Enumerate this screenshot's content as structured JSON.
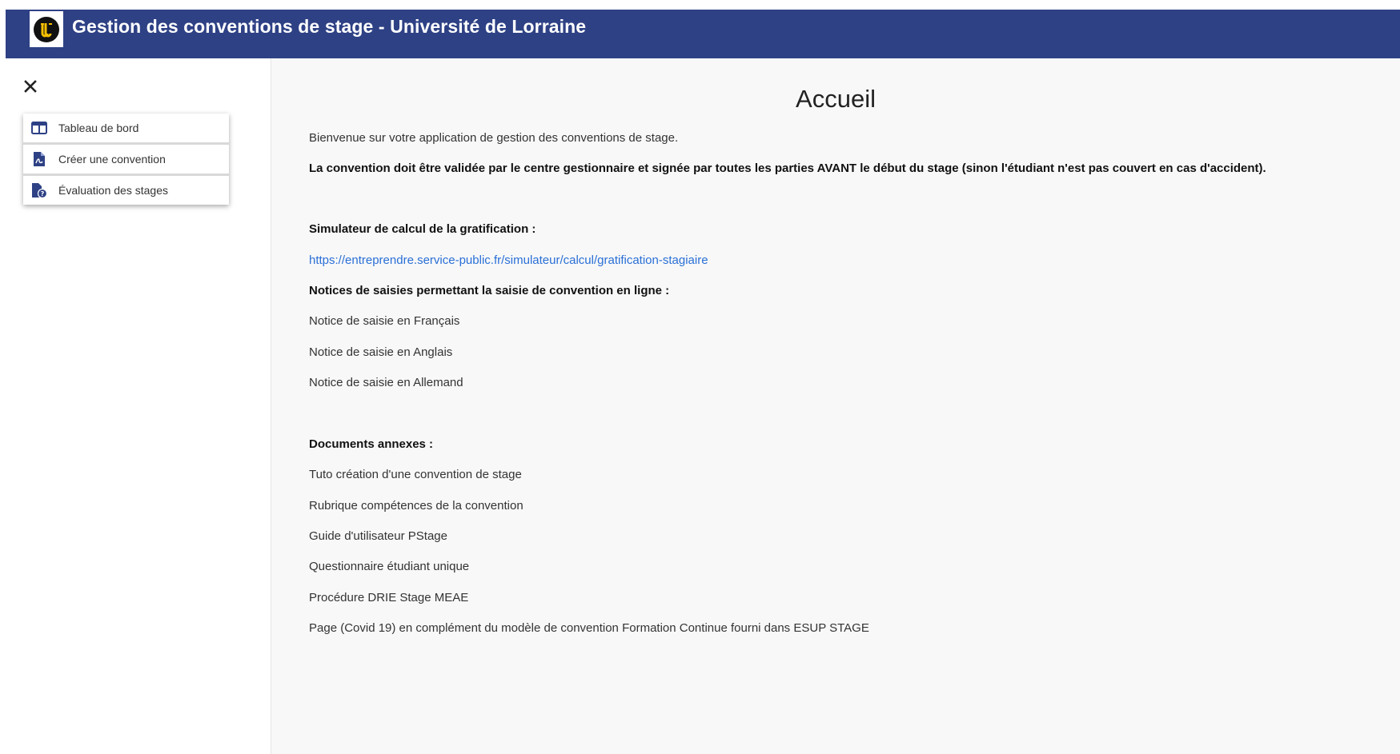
{
  "header": {
    "title": "Gestion des conventions de stage - Université de Lorraine",
    "logo_icon": "universite-de-lorraine-logo",
    "bar_color": "#2e4185"
  },
  "sidebar": {
    "close_icon": "close-icon",
    "items": [
      {
        "label": "Tableau de bord",
        "icon": "dashboard-icon"
      },
      {
        "label": "Créer une convention",
        "icon": "pdf-document-icon"
      },
      {
        "label": "Évaluation des stages",
        "icon": "file-question-icon"
      }
    ]
  },
  "main": {
    "title": "Accueil",
    "welcome": "Bienvenue sur votre application de gestion des conventions de stage.",
    "warning": "La convention doit être validée par le centre gestionnaire et signée par toutes les parties AVANT le début du stage (sinon l'étudiant n'est pas couvert en cas d'accident).",
    "simulator_heading": "Simulateur de calcul de la gratification :",
    "simulator_link": "https://entreprendre.service-public.fr/simulateur/calcul/gratification-stagiaire",
    "notices_heading": "Notices de saisies permettant la saisie de convention en ligne :",
    "notices": [
      "Notice de saisie en Français",
      "Notice de saisie en Anglais",
      "Notice de saisie en Allemand"
    ],
    "documents_heading": "Documents annexes :",
    "documents": [
      "Tuto création d'une convention de stage",
      "Rubrique compétences de la convention",
      "Guide d'utilisateur PStage",
      "Questionnaire étudiant unique",
      "Procédure DRIE Stage MEAE",
      "Page (Covid 19) en complément du modèle de convention Formation Continue fourni dans ESUP STAGE"
    ],
    "link_color": "#2a6fd6"
  }
}
